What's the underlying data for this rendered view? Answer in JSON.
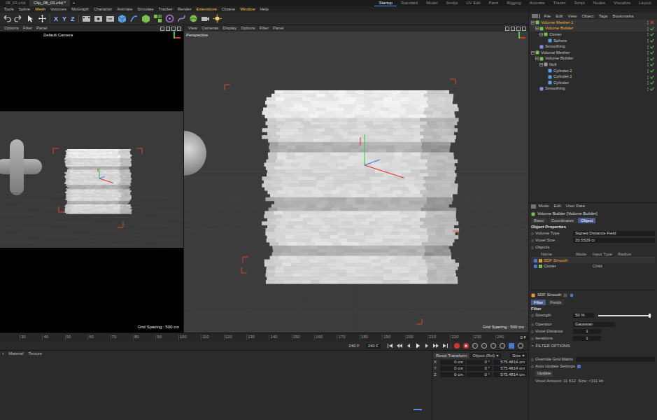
{
  "title_bar": {
    "tabs": [
      {
        "label": "08_03.c4d",
        "selected": false
      },
      {
        "label": "Clip_08_03.c4d *",
        "selected": true
      }
    ],
    "new_tab": "+"
  },
  "layouts": [
    {
      "label": "Startup",
      "selected": true
    },
    {
      "label": "Standard",
      "selected": false
    },
    {
      "label": "Model",
      "selected": false
    },
    {
      "label": "Sculpt",
      "selected": false
    },
    {
      "label": "UV Edit",
      "selected": false
    },
    {
      "label": "Paint",
      "selected": false
    },
    {
      "label": "Rigging",
      "selected": false
    },
    {
      "label": "Animate",
      "selected": false
    },
    {
      "label": "Tracks",
      "selected": false
    },
    {
      "label": "Script",
      "selected": false
    },
    {
      "label": "Nodes",
      "selected": false
    },
    {
      "label": "Visualize",
      "selected": false
    },
    {
      "label": "Layout",
      "selected": false
    }
  ],
  "menu": [
    {
      "label": "Tools",
      "highlighted": false
    },
    {
      "label": "Spline",
      "highlighted": false
    },
    {
      "label": "Mesh",
      "highlighted": true
    },
    {
      "label": "Volumes",
      "highlighted": false
    },
    {
      "label": "MoGraph",
      "highlighted": false
    },
    {
      "label": "Character",
      "highlighted": false
    },
    {
      "label": "Animate",
      "highlighted": false
    },
    {
      "label": "Simulate",
      "highlighted": false
    },
    {
      "label": "Tracker",
      "highlighted": false
    },
    {
      "label": "Render",
      "highlighted": false
    },
    {
      "label": "Extensions",
      "highlighted": true
    },
    {
      "label": "Octane",
      "highlighted": false
    },
    {
      "label": "Window",
      "highlighted": true
    },
    {
      "label": "Help",
      "highlighted": false
    }
  ],
  "toolbar": {
    "axes": [
      "X",
      "Y",
      "Z"
    ]
  },
  "viewports": [
    {
      "menu": [
        "Options",
        "Filter",
        "Panel"
      ],
      "camera": "Default Camera",
      "grid": "Grid Spacing : 500 cm"
    },
    {
      "menu": [
        "View",
        "Cameras",
        "Display",
        "Options",
        "Filter",
        "Panel"
      ],
      "camera": "Perspective",
      "grid": "Grid Spacing : 500 cm"
    }
  ],
  "timeline": {
    "ticks": [
      "30",
      "40",
      "50",
      "60",
      "70",
      "80",
      "90",
      "100",
      "110",
      "120",
      "130",
      "140",
      "150",
      "160",
      "170",
      "180",
      "190",
      "200",
      "210",
      "220",
      "230",
      "240"
    ],
    "current_frame": "0 F",
    "end_frame": "240 F",
    "max_frame": "240 F"
  },
  "material_panel": {
    "menu": [
      "t",
      "Material",
      "Texture"
    ]
  },
  "coordinates": {
    "reset": "Reset Transform",
    "mode": "Object (Rel)",
    "size_mode": "Size",
    "rows": [
      {
        "axis": "X",
        "position": "0 cm",
        "rotation": "0 °",
        "size": "575.4814 cm"
      },
      {
        "axis": "Y",
        "position": "0 cm",
        "rotation": "0 °",
        "size": "575.4814 cm"
      },
      {
        "axis": "Z",
        "position": "0 cm",
        "rotation": "0 °",
        "size": "575.4814 cm"
      }
    ]
  },
  "object_manager": {
    "menu": [
      "File",
      "Edit",
      "View",
      "Object",
      "Tags",
      "Bookmarks"
    ],
    "items": [
      {
        "label": "Volume Mesher.1",
        "level": 0,
        "kind": "mesher",
        "expanded": true,
        "selected": true,
        "enabled": false
      },
      {
        "label": "Volume Builder",
        "level": 1,
        "kind": "builder",
        "expanded": true,
        "selected": true,
        "enabled": true
      },
      {
        "label": "Cloner",
        "level": 2,
        "kind": "cloner",
        "expanded": true,
        "selected": false,
        "enabled": true
      },
      {
        "label": "Sphere",
        "level": 3,
        "kind": "primitive",
        "expanded": false,
        "selected": false,
        "enabled": true
      },
      {
        "label": "Smoothing",
        "level": 1,
        "kind": "deformer",
        "expanded": false,
        "selected": false,
        "enabled": true
      },
      {
        "label": "Volume Mesher",
        "level": 0,
        "kind": "mesher",
        "expanded": true,
        "selected": false,
        "enabled": true
      },
      {
        "label": "Volume Builder",
        "level": 1,
        "kind": "builder",
        "expanded": true,
        "selected": false,
        "enabled": true
      },
      {
        "label": "Null",
        "level": 2,
        "kind": "null",
        "expanded": true,
        "selected": false,
        "enabled": true
      },
      {
        "label": "Cylinder.2",
        "level": 3,
        "kind": "primitive",
        "expanded": false,
        "selected": false,
        "enabled": true
      },
      {
        "label": "Cylinder.1",
        "level": 3,
        "kind": "primitive",
        "expanded": false,
        "selected": false,
        "enabled": true
      },
      {
        "label": "Cylinder",
        "level": 3,
        "kind": "primitive",
        "expanded": false,
        "selected": false,
        "enabled": true
      },
      {
        "label": "Smoothing",
        "level": 1,
        "kind": "deformer",
        "expanded": false,
        "selected": false,
        "enabled": true
      }
    ]
  },
  "attributes": {
    "menu": [
      "Mode",
      "Edit",
      "User Data"
    ],
    "title": "Volume Builder [Volume Builder]",
    "tabs": [
      {
        "label": "Basic",
        "selected": false
      },
      {
        "label": "Coordinates",
        "selected": false
      },
      {
        "label": "Object",
        "selected": true
      }
    ],
    "section": "Object Properties",
    "fields": [
      {
        "label": "Volume Type",
        "value": "Signed Distance Field"
      },
      {
        "label": "Voxel Size",
        "value": "20.5529 cr"
      }
    ],
    "objects_label": "Objects",
    "columns": [
      "Name",
      "Mode",
      "Input Type",
      "Radius"
    ],
    "rows": [
      {
        "name": "SDF Smooth",
        "checked": true,
        "selected": true
      },
      {
        "name": "Cloner",
        "input_type": "Child",
        "checked": true,
        "selected": false
      }
    ]
  },
  "filter_panel": {
    "title": "SDF Smooth",
    "tabs": [
      {
        "label": "Filter",
        "selected": true
      },
      {
        "label": "Fields",
        "selected": false
      }
    ],
    "section": "Filter",
    "strength": {
      "label": "Strength",
      "value": "50 %",
      "level": 0.95
    },
    "fields": [
      {
        "label": "Operator",
        "value": "Gaussian"
      },
      {
        "label": "Voxel Distance",
        "value": "1"
      },
      {
        "label": "Iterations",
        "value": "1"
      }
    ],
    "expander": ">",
    "filter_options": "FILTER OPTIONS",
    "override": "Override Grid Matrix",
    "auto_update": {
      "label": "Auto Update Settings",
      "checked": true
    },
    "update_button": "Update",
    "status": "Voxel Amount: 11 612  Size: <311 kb"
  }
}
